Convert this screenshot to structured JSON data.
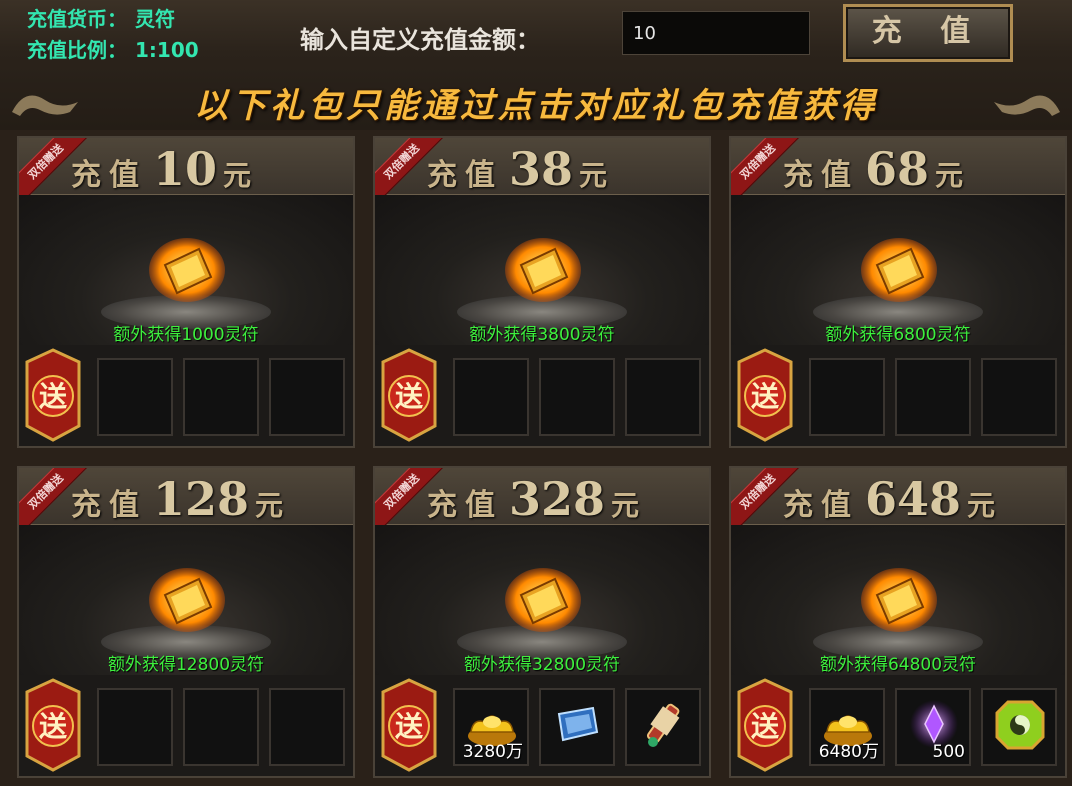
{
  "currency": {
    "currency_label": "充值货币：",
    "currency_value": "灵符",
    "ratio_label": "充值比例：",
    "ratio_value": "1:100"
  },
  "custom_recharge": {
    "label": "输入自定义充值金额：",
    "amount_value": "10",
    "button_label": "充 值"
  },
  "banner": {
    "text": "以下礼包只能通过点击对应礼包充值获得"
  },
  "packages": [
    {
      "prefix": "充值",
      "amount": "10",
      "unit": "元",
      "ribbon": "双倍赠送",
      "bonus": "额外获得1000灵符",
      "gift_badge": "送",
      "items": []
    },
    {
      "prefix": "充值",
      "amount": "38",
      "unit": "元",
      "ribbon": "双倍赠送",
      "bonus": "额外获得3800灵符",
      "gift_badge": "送",
      "items": []
    },
    {
      "prefix": "充值",
      "amount": "68",
      "unit": "元",
      "ribbon": "双倍赠送",
      "bonus": "额外获得6800灵符",
      "gift_badge": "送",
      "items": []
    },
    {
      "prefix": "充值",
      "amount": "128",
      "unit": "元",
      "ribbon": "双倍赠送",
      "bonus": "额外获得12800灵符",
      "gift_badge": "送",
      "items": []
    },
    {
      "prefix": "充值",
      "amount": "328",
      "unit": "元",
      "ribbon": "双倍赠送",
      "bonus": "额外获得32800灵符",
      "gift_badge": "送",
      "items": [
        {
          "icon": "gold-ingot-icon",
          "count": "3280万"
        },
        {
          "icon": "blue-scroll-icon",
          "count": ""
        },
        {
          "icon": "red-scroll-icon",
          "count": ""
        }
      ]
    },
    {
      "prefix": "充值",
      "amount": "648",
      "unit": "元",
      "ribbon": "双倍赠送",
      "bonus": "额外获得64800灵符",
      "gift_badge": "送",
      "items": [
        {
          "icon": "gold-ingot-icon",
          "count": "6480万"
        },
        {
          "icon": "purple-crystal-icon",
          "count": "500"
        },
        {
          "icon": "jade-pendant-icon",
          "count": ""
        }
      ]
    }
  ],
  "colors": {
    "accent_gold": "#f7b93e",
    "bonus_green": "#3df03d",
    "info_cyan": "#33e6b0",
    "ribbon_red": "#8e1616"
  }
}
